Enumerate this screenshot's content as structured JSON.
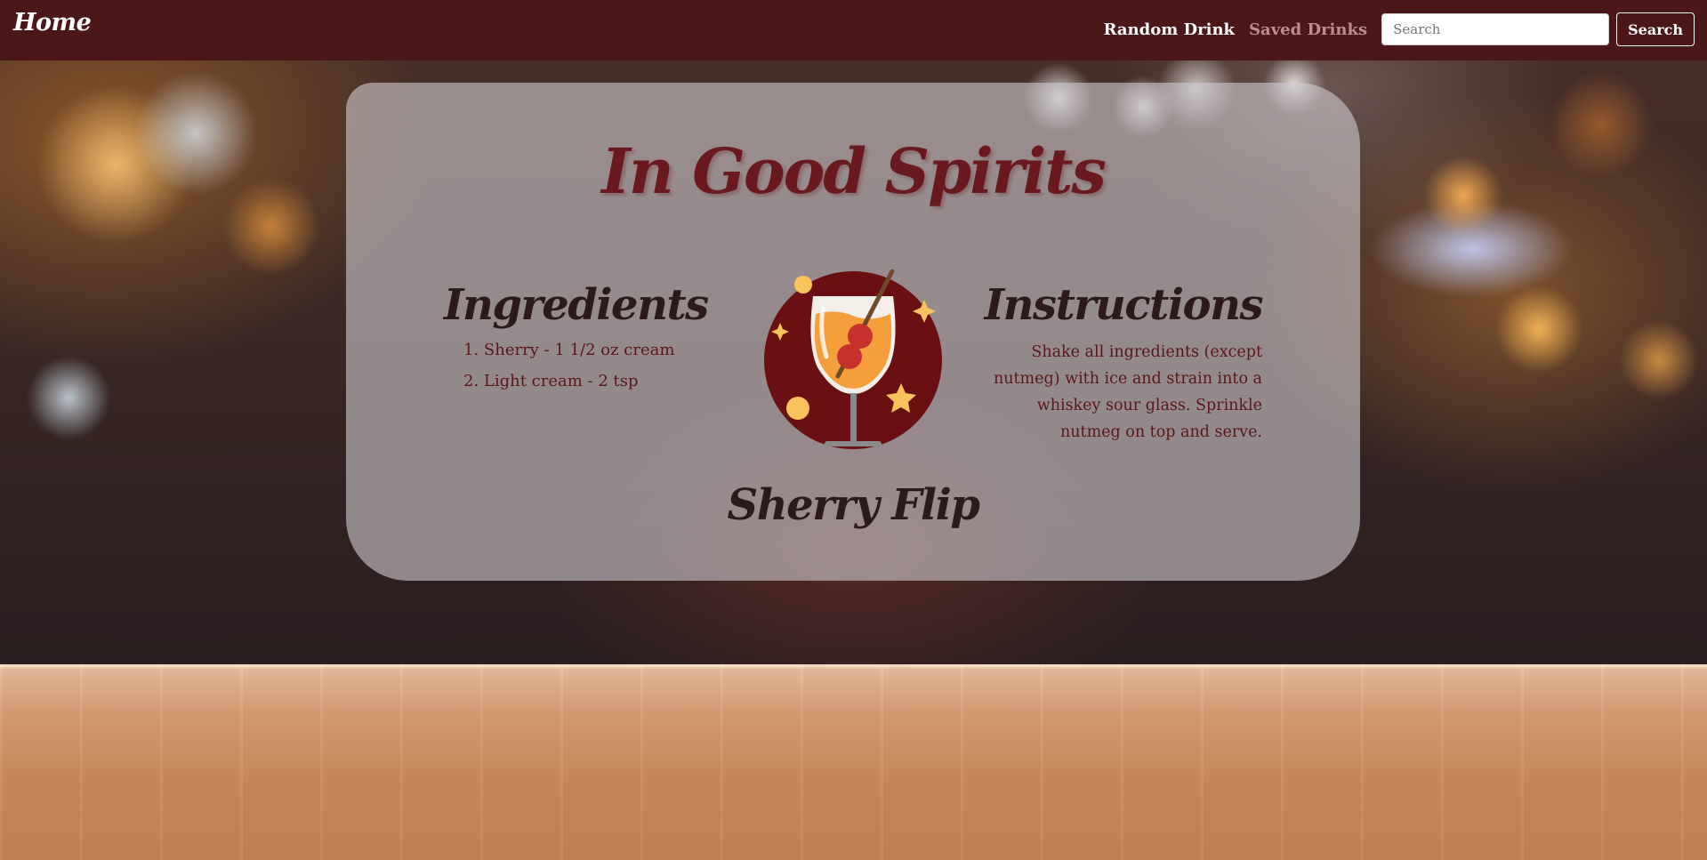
{
  "navbar": {
    "brand": "Home",
    "random_drink": "Random Drink",
    "saved_drinks": "Saved Drinks",
    "search_placeholder": "Search",
    "search_button": "Search"
  },
  "site_title": "In Good Spirits",
  "ingredients": {
    "heading": "Ingredients",
    "items": [
      "1. Sherry - 1 1/2 oz cream",
      "2. Light cream - 2 tsp"
    ]
  },
  "instructions": {
    "heading": "Instructions",
    "text": "Shake all ingredients (except nutmeg) with ice and strain into a whiskey sour glass. Sprinkle nutmeg on top and serve."
  },
  "drink": {
    "name": "Sherry Flip",
    "icon": "cocktail-glass-icon"
  },
  "colors": {
    "navbar": "#4b1719",
    "title": "#6a1a1e",
    "accent_text": "#5a1518",
    "icon_circle": "#6b1012",
    "icon_drink": "#f59e3c",
    "icon_cherry": "#c7322d",
    "icon_stars": "#f7c35a"
  }
}
